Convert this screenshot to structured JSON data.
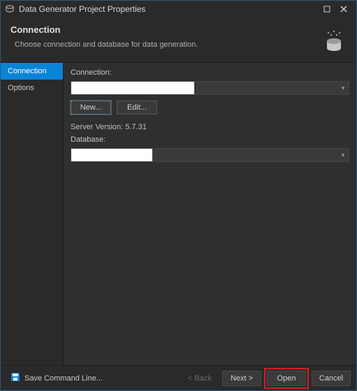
{
  "title": "Data Generator Project Properties",
  "header": {
    "heading": "Connection",
    "subheading": "Choose connection and database for data generation."
  },
  "sidebar": {
    "items": [
      {
        "label": "Connection",
        "selected": true
      },
      {
        "label": "Options",
        "selected": false
      }
    ]
  },
  "form": {
    "connection_label": "Connection:",
    "connection_value": "",
    "new_label": "New...",
    "edit_label": "Edit...",
    "server_version_label": "Server Version: 5.7.31",
    "database_label": "Database:",
    "database_value": ""
  },
  "footer": {
    "save_cmd": "Save Command Line...",
    "back": "< Back",
    "next": "Next >",
    "open": "Open",
    "cancel": "Cancel"
  }
}
